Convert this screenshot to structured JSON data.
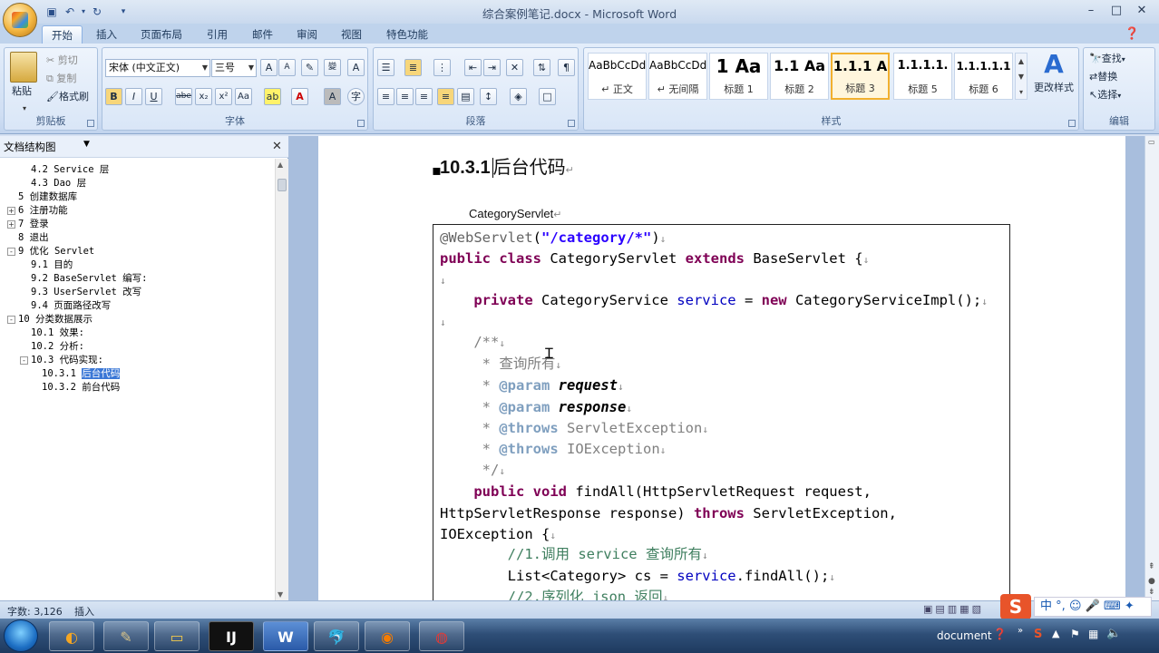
{
  "window": {
    "title": "综合案例笔记.docx - Microsoft Word",
    "controls": [
      "–",
      "□",
      "✕"
    ]
  },
  "tabs": [
    "开始",
    "插入",
    "页面布局",
    "引用",
    "邮件",
    "审阅",
    "视图",
    "特色功能"
  ],
  "ribbon": {
    "clipboard": {
      "label": "剪贴板",
      "paste": "粘贴",
      "cut": "剪切",
      "copy": "复制",
      "format_painter": "格式刷"
    },
    "font": {
      "label": "字体",
      "font_name": "宋体 (中文正文)",
      "font_size": "三号"
    },
    "paragraph": {
      "label": "段落"
    },
    "styles": {
      "label": "样式",
      "items": [
        {
          "preview": "AaBbCcDd",
          "name": "↵ 正文"
        },
        {
          "preview": "AaBbCcDd",
          "name": "↵ 无间隔"
        },
        {
          "preview": "1  Aa",
          "name": "标题 1"
        },
        {
          "preview": "1.1  Aa",
          "name": "标题 2"
        },
        {
          "preview": "1.1.1  A",
          "name": "标题 3"
        },
        {
          "preview": "1.1.1.1.",
          "name": "标题 5"
        },
        {
          "preview": "1.1.1.1.1",
          "name": "标题 6"
        }
      ],
      "change": "更改样式"
    },
    "editing": {
      "label": "编辑",
      "find": "查找",
      "replace": "替换",
      "select": "选择"
    }
  },
  "nav": {
    "title": "文档结构图",
    "items": [
      {
        "text": "4.2 Service 层",
        "level": 2
      },
      {
        "text": "4.3 Dao 层",
        "level": 2
      },
      {
        "text": "5 创建数据库",
        "level": 1
      },
      {
        "text": "6 注册功能",
        "level": 1,
        "exp": "+"
      },
      {
        "text": "7 登录",
        "level": 1,
        "exp": "+"
      },
      {
        "text": "8 退出",
        "level": 1
      },
      {
        "text": "9 优化 Servlet",
        "level": 1,
        "exp": "-"
      },
      {
        "text": "9.1 目的",
        "level": 2
      },
      {
        "text": "9.2 BaseServlet 编写:",
        "level": 2
      },
      {
        "text": "9.3 UserServlet 改写",
        "level": 2
      },
      {
        "text": "9.4 页面路径改写",
        "level": 2
      },
      {
        "text": "10 分类数据展示",
        "level": 1,
        "exp": "-"
      },
      {
        "text": "10.1 效果:",
        "level": 2
      },
      {
        "text": "10.2  分析:",
        "level": 2
      },
      {
        "text": "10.3 代码实现:",
        "level": 2,
        "exp": "-"
      },
      {
        "text": "10.3.1",
        "level": 3,
        "sel": "后台代码"
      },
      {
        "text": "10.3.2 前台代码",
        "level": 3
      }
    ]
  },
  "document": {
    "heading_num": "10.3.1",
    "heading_text": "后台代码",
    "caption": "CategoryServlet"
  },
  "status": {
    "words": "字数: 3,126",
    "mode": "插入"
  },
  "taskbar": {
    "document_label": "document"
  },
  "ime": {
    "lang": "中"
  }
}
